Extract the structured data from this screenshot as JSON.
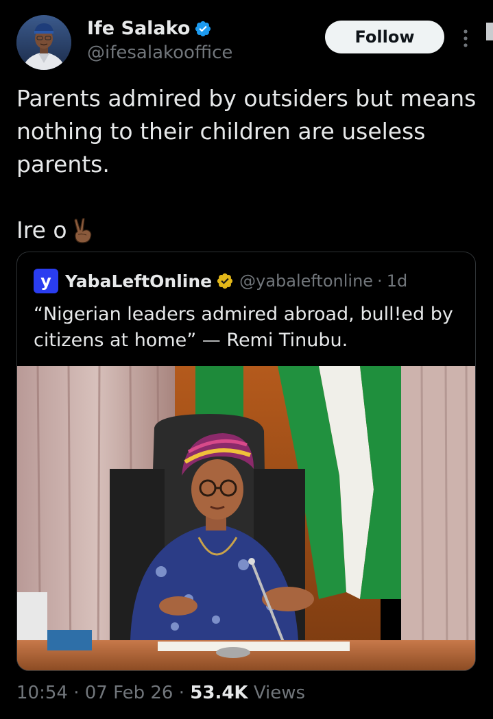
{
  "tweet": {
    "author": {
      "name": "Ife Salako",
      "handle": "@ifesalakooffice",
      "verified_badge_color": "#1d9bf0"
    },
    "follow_label": "Follow",
    "text_paragraph_1": "Parents admired by outsiders but means nothing to their children are useless parents.",
    "text_paragraph_2": "Ire o",
    "text_emoji": "victory-hand-medium-dark-skin",
    "quoted": {
      "avatar_letter": "y",
      "name": "YabaLeftOnline",
      "badge": "gold-verified-badge",
      "handle": "@yabaleftonline",
      "time": "1d",
      "text": "“Nigerian leaders admired abroad, bull!ed by citizens at home” — Remi Tinubu."
    },
    "footer": {
      "time": "10:54",
      "date": "07 Feb 26",
      "views_count": "53.4K",
      "views_label": "Views"
    }
  },
  "colors": {
    "background": "#000000",
    "primary_text": "#e7e9ea",
    "secondary_text": "#71767b",
    "border": "#2f3336",
    "follow_bg": "#eff3f4",
    "gold_badge": "#e2b719"
  }
}
